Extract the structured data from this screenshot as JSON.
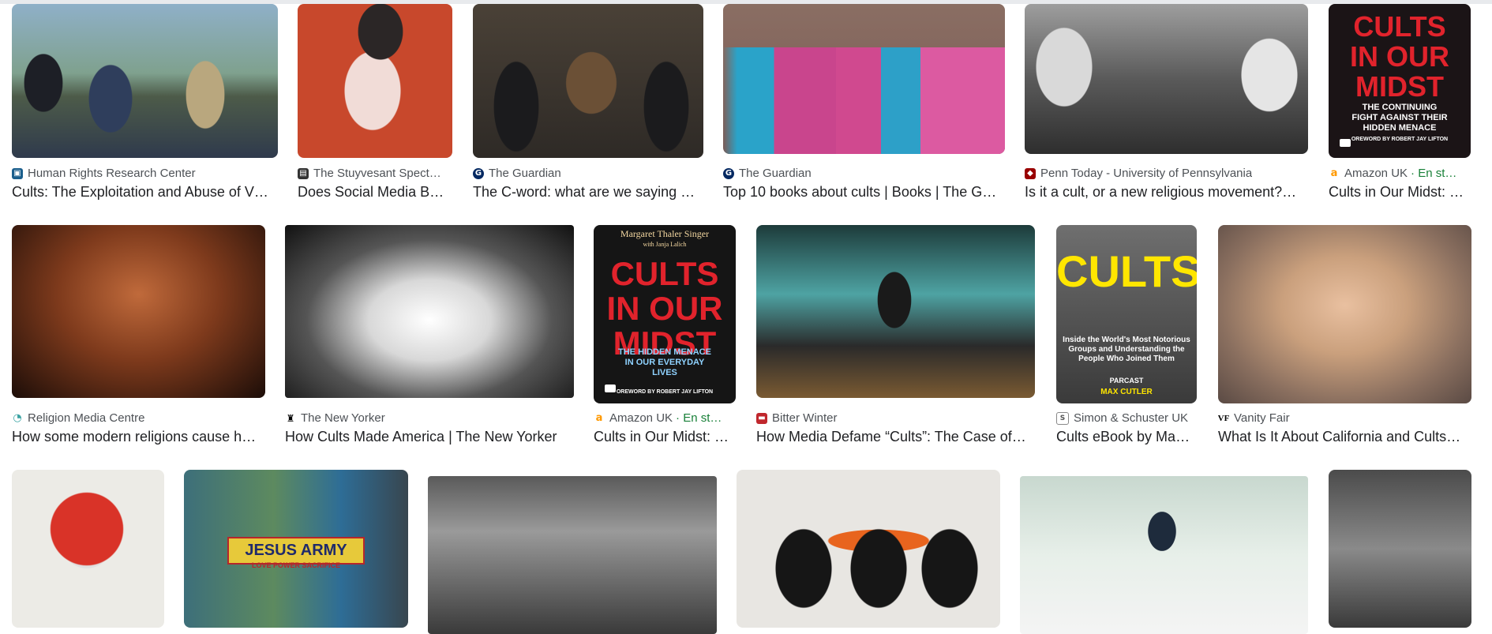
{
  "results": [
    {
      "source": "Human Rights Research Center",
      "title": "Cults: The Exploitation and Abuse of V…",
      "favicon": "camera-icon"
    },
    {
      "source": "The Stuyvesant Spect…",
      "title": "Does Social Media B…",
      "favicon": "newspaper-icon"
    },
    {
      "source": "The Guardian",
      "title": "The C-word: what are we saying …",
      "favicon": "guardian-g-icon"
    },
    {
      "source": "The Guardian",
      "title": "Top 10 books about cults | Books | The G…",
      "favicon": "guardian-g-icon"
    },
    {
      "source": "Penn Today - University of Pennsylvania",
      "title": "Is it a cult, or a new religious movement?…",
      "favicon": "shield-icon"
    },
    {
      "source": "Amazon UK",
      "extra": " · En st…",
      "title": "Cults in Our Midst: …",
      "favicon": "amazon-icon",
      "cover_title": "CULTS\nIN OUR MIDST",
      "cover_sub": "THE CONTINUING\nFIGHT AGAINST THEIR\nHIDDEN MENACE",
      "cover_credit": "OREWORD BY ROBERT JAY LIFTON"
    },
    {
      "source": "Religion Media Centre",
      "title": "How some modern religions cause h…",
      "favicon": "swirl-icon"
    },
    {
      "source": "The New Yorker",
      "title": "How Cults Made America | The New Yorker",
      "favicon": "eustace-icon"
    },
    {
      "source": "Amazon UK",
      "extra": " · En st…",
      "title": "Cults in Our Midst: …",
      "favicon": "amazon-icon",
      "cover_author": "Margaret Thaler Singer",
      "cover_coauthor": "with Janja Lalich",
      "cover_title": "CULTS\nIN OUR MIDST",
      "cover_sub": "THE HIDDEN MENACE\nIN OUR EVERYDAY\nLIVES",
      "cover_credit": "OREWORD BY ROBERT JAY LIFTON"
    },
    {
      "source": "Bitter Winter",
      "title": "How Media Defame “Cults”: The Case of…",
      "favicon": "bw-icon"
    },
    {
      "source": "Simon & Schuster UK",
      "title": "Cults eBook by Ma…",
      "favicon": "ss-icon",
      "cover_title": "CULTS",
      "cover_sub": "Inside the World's Most Notorious\nGroups and Understanding the\nPeople Who Joined Them",
      "cover_publisher": "PARCAST",
      "cover_author": "MAX CUTLER"
    },
    {
      "source": "Vanity Fair",
      "title": "What Is It About California and Cults…",
      "favicon": "vf-icon"
    },
    {
      "jacket_text": "JESUS ARMY",
      "jacket_motto": "LOVE POWER SACRIFICE"
    }
  ]
}
